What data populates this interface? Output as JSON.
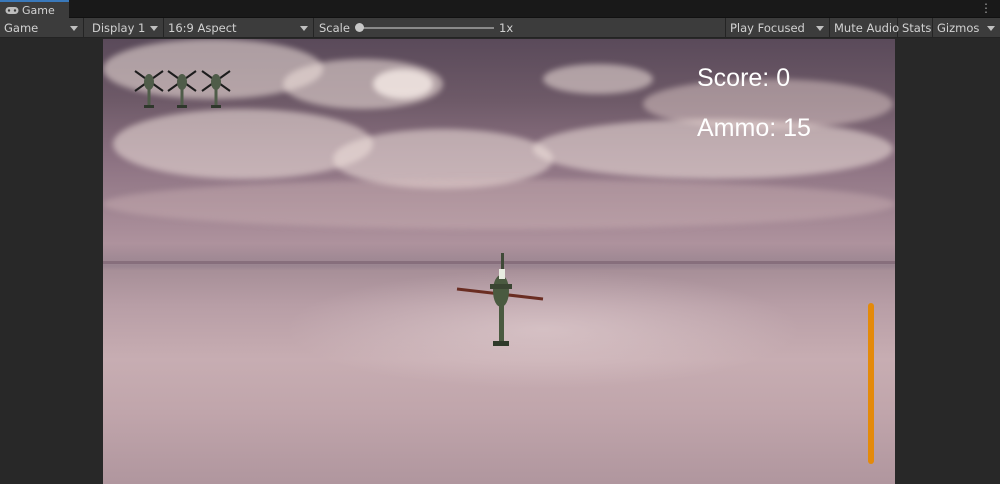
{
  "tab": {
    "title": "Game",
    "icon": "gamepad-icon"
  },
  "toolbar": {
    "mode": "Game",
    "display": "Display 1",
    "aspect": "16:9 Aspect",
    "scale_label": "Scale",
    "scale_value": "1x",
    "play_mode": "Play Focused",
    "mute": "Mute Audio",
    "stats": "Stats",
    "gizmos": "Gizmos"
  },
  "hud": {
    "score_text": "Score: 0",
    "ammo_text": "Ammo: 15",
    "lives": 3,
    "ammo_bar_color": "#e48a0a"
  }
}
